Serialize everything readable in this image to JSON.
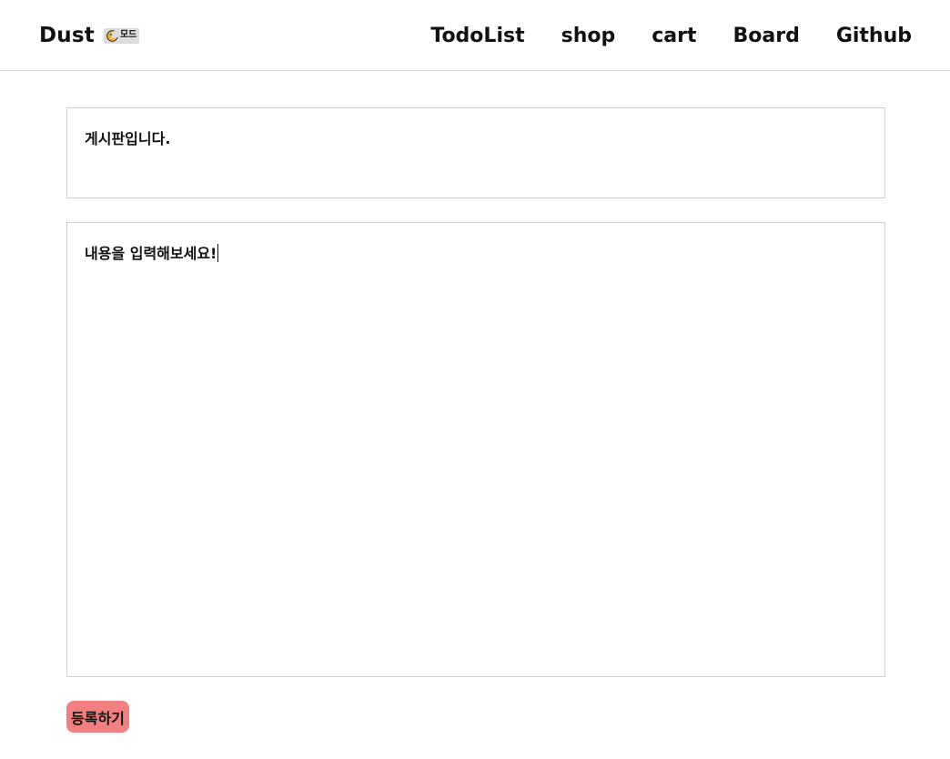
{
  "header": {
    "brand": "Dust",
    "mode_toggle": {
      "icon": "moon-icon",
      "label": "모드"
    },
    "nav": [
      {
        "label": "TodoList"
      },
      {
        "label": "shop"
      },
      {
        "label": "cart"
      },
      {
        "label": "Board"
      },
      {
        "label": "Github"
      }
    ]
  },
  "form": {
    "title_value": "게시판입니다.",
    "content_value": "내용을 입력해보세요!",
    "submit_label": "등록하기"
  },
  "colors": {
    "submit_background": "#f28080",
    "moon_icon": "#f5b82e",
    "border": "#cfcfcf"
  }
}
